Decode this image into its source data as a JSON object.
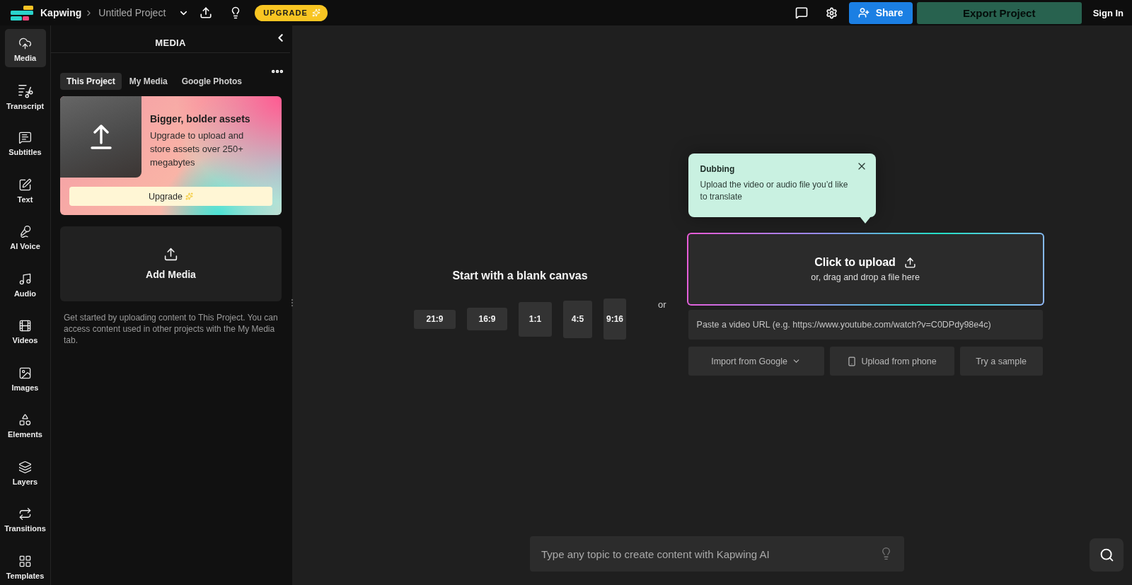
{
  "top_bar": {
    "brand": "Kapwing",
    "project_title": "Untitled Project",
    "upgrade_badge": "UPGRADE",
    "share_button": "Share",
    "export_button": "Export Project",
    "sign_in": "Sign In"
  },
  "sidebar": {
    "items": [
      {
        "label": "Media",
        "selected": true
      },
      {
        "label": "Transcript",
        "selected": false
      },
      {
        "label": "Subtitles",
        "selected": false
      },
      {
        "label": "Text",
        "selected": false
      },
      {
        "label": "AI Voice",
        "selected": false
      },
      {
        "label": "Audio",
        "selected": false
      },
      {
        "label": "Videos",
        "selected": false
      },
      {
        "label": "Images",
        "selected": false
      },
      {
        "label": "Elements",
        "selected": false
      },
      {
        "label": "Layers",
        "selected": false
      },
      {
        "label": "Transitions",
        "selected": false
      },
      {
        "label": "Templates",
        "selected": false
      }
    ]
  },
  "media_panel": {
    "title": "MEDIA",
    "tabs": [
      {
        "label": "This Project",
        "selected": true
      },
      {
        "label": "My Media",
        "selected": false
      },
      {
        "label": "Google Photos",
        "selected": false
      }
    ],
    "promo": {
      "title": "Bigger, bolder assets",
      "text": "Upgrade to upload and store assets over 250+ megabytes",
      "button": "Upgrade"
    },
    "add_media": "Add Media",
    "help_text": "Get started by uploading content to This Project. You can access content used in other projects with the My Media tab."
  },
  "canvas": {
    "blank_canvas": {
      "title": "Start with a blank canvas",
      "ratios": [
        "21:9",
        "16:9",
        "1:1",
        "4:5",
        "9:16"
      ]
    },
    "separator": "or",
    "upload": {
      "tooltip": {
        "title": "Dubbing",
        "text": "Upload the video or audio file you’d like to translate"
      },
      "title": "Click to upload",
      "subtitle": "or, drag and drop a file here",
      "url_field": {
        "placeholder": "Paste a video URL (e.g. https://www.youtube.com/watch?v=C0DPdy98e4c)"
      },
      "buttons": [
        {
          "kind": "dropdown",
          "label": "Import from Google"
        },
        {
          "kind": "phone",
          "label": "Upload from phone"
        },
        {
          "kind": "plain",
          "label": "Try a sample"
        }
      ]
    },
    "ai_prompt": {
      "placeholder": "Type any topic to create content with Kapwing AI"
    }
  }
}
